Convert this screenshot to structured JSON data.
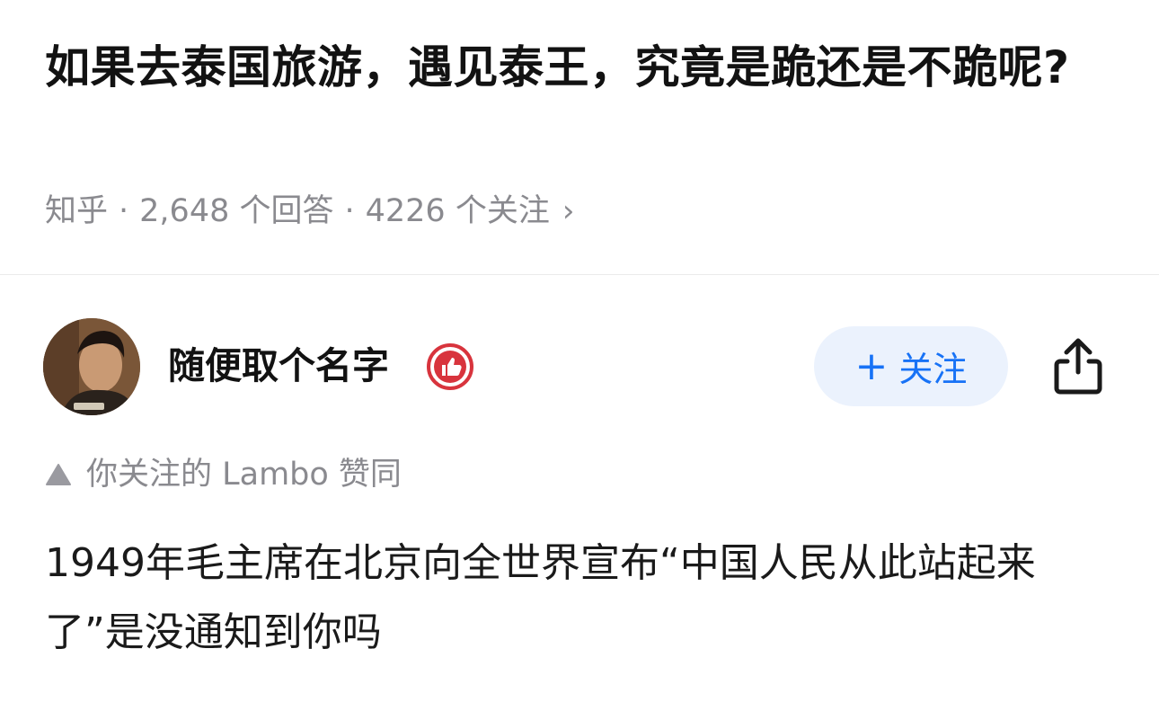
{
  "question": {
    "title": "如果去泰国旅游，遇见泰王，究竟是跪还是不跪呢?",
    "meta": {
      "source": "知乎",
      "answers": "2,648 个回答",
      "followers": "4226 个关注",
      "separator": "·",
      "chevron": "›"
    }
  },
  "author": {
    "name": "随便取个名字",
    "badge_icon": "thumbs-up-badge-icon",
    "follow_button": {
      "plus": "+",
      "label": "关注"
    },
    "share_icon": "share-icon"
  },
  "answer": {
    "upvote_note": "你关注的 Lambo 赞同",
    "body": "1949年毛主席在北京向全世界宣布“中国人民从此站起来了”是没通知到你吗"
  },
  "colors": {
    "accent": "#1772f6",
    "follow_bg": "#ebf2fd",
    "meta_text": "#8a8a8f",
    "badge_red": "#d8343d"
  }
}
